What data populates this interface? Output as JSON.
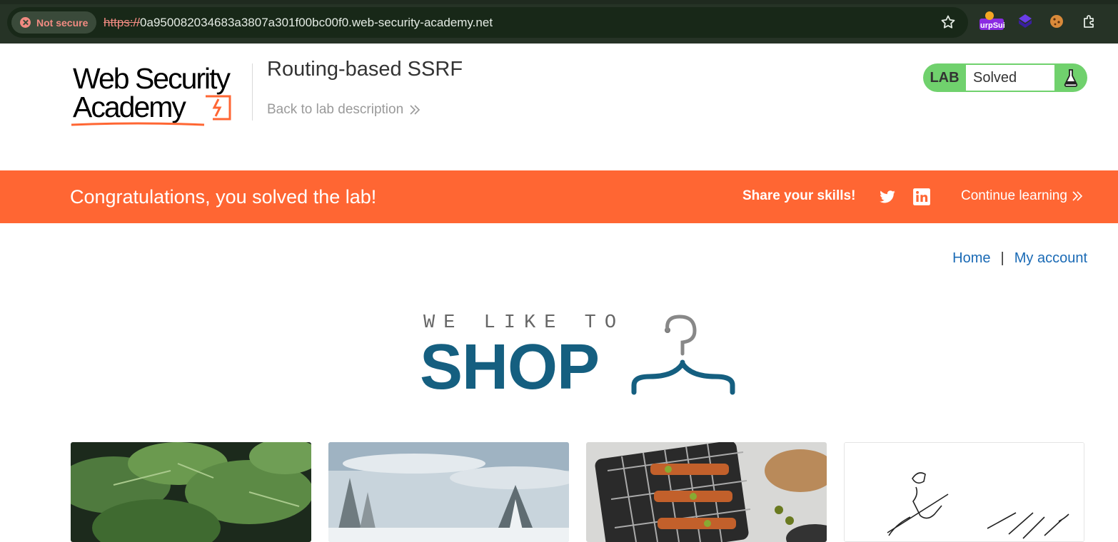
{
  "browser": {
    "security_label": "Not secure",
    "url_scheme": "https://",
    "url_host": "0a950082034683a3807a301f00bc00f0.web-security-academy.net",
    "extension_label": "urpSui"
  },
  "header": {
    "logo_line1": "Web Security",
    "logo_line2": "Academy",
    "lab_title": "Routing-based SSRF",
    "back_link": "Back to lab description",
    "lab_badge_label": "LAB",
    "lab_status": "Solved"
  },
  "banner": {
    "message": "Congratulations, you solved the lab!",
    "share_label": "Share your skills!",
    "continue_label": "Continue learning"
  },
  "nav": {
    "home": "Home",
    "separator": "|",
    "account": "My account"
  },
  "shop_logo": {
    "tagline": "WE LIKE TO",
    "title": "SHOP"
  },
  "colors": {
    "accent_orange": "#ff6633",
    "lab_green": "#70d16d",
    "link_blue": "#1a6ab5",
    "shop_blue": "#155f80"
  }
}
